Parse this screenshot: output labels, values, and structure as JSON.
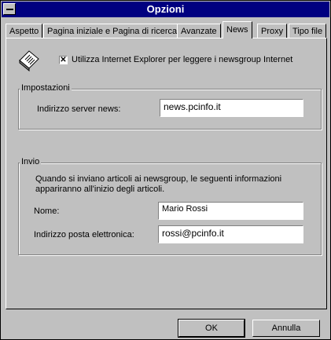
{
  "window": {
    "title": "Opzioni"
  },
  "tabs": [
    {
      "label": "Aspetto"
    },
    {
      "label": "Pagina iniziale e Pagina di ricerca"
    },
    {
      "label": "Avanzate"
    },
    {
      "label": "News",
      "active": true
    },
    {
      "label": "Proxy"
    },
    {
      "label": "Tipo file"
    }
  ],
  "news": {
    "use_ie_label": "Utilizza Internet Explorer per leggere i newsgroup Internet",
    "use_ie_checked": true,
    "checkmark": "✕"
  },
  "settings": {
    "title": "Impostazioni",
    "server_label": "Indirizzo server news:",
    "server_value": "news.pcinfo.it"
  },
  "send": {
    "title": "Invio",
    "description_line1": "Quando si inviano articoli ai newsgroup, le seguenti informazioni",
    "description_line2": "appariranno all'inizio degli articoli.",
    "name_label": "Nome:",
    "name_value": "Mario Rossi",
    "email_label": "Indirizzo posta elettronica:",
    "email_value": "rossi@pcinfo.it"
  },
  "buttons": {
    "ok": "OK",
    "cancel": "Annulla"
  }
}
